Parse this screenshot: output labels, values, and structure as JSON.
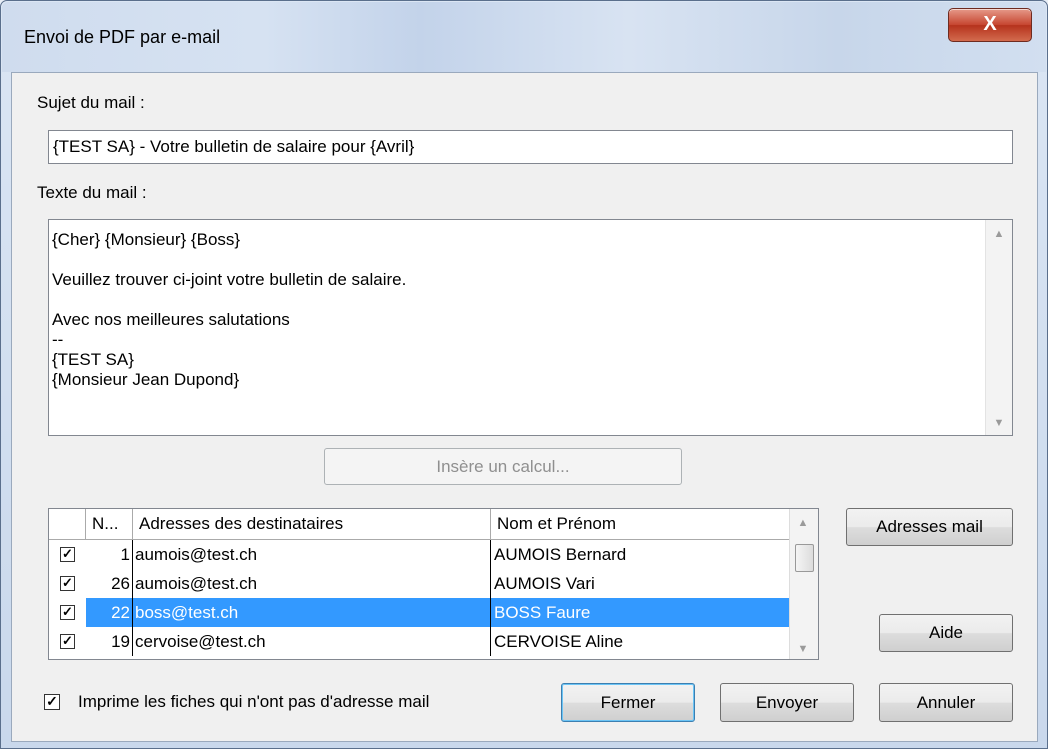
{
  "window": {
    "title": "Envoi de PDF par e-mail",
    "close_glyph": "X"
  },
  "subject": {
    "label": "Sujet du mail :",
    "value": "{TEST SA} - Votre bulletin de salaire pour {Avril}"
  },
  "body": {
    "label": "Texte du mail :",
    "lines": [
      "{Cher} {Monsieur} {Boss}",
      "",
      "Veuillez trouver ci-joint votre bulletin de salaire.",
      "",
      "Avec nos meilleures salutations",
      "--",
      "{TEST SA}",
      "{Monsieur Jean Dupond}"
    ]
  },
  "insert_calc_label": "Insère un calcul...",
  "recipients": {
    "columns": [
      "N...",
      "Adresses des destinataires",
      "Nom et Prénom"
    ],
    "rows": [
      {
        "checked": true,
        "num": "1",
        "email": "aumois@test.ch",
        "name": "AUMOIS Bernard",
        "selected": false
      },
      {
        "checked": true,
        "num": "26",
        "email": "aumois@test.ch",
        "name": "AUMOIS Vari",
        "selected": false
      },
      {
        "checked": true,
        "num": "22",
        "email": "boss@test.ch",
        "name": "BOSS Faure",
        "selected": true
      },
      {
        "checked": true,
        "num": "19",
        "email": "cervoise@test.ch",
        "name": "CERVOISE Aline",
        "selected": false
      }
    ]
  },
  "buttons": {
    "addresses": "Adresses mail",
    "help": "Aide",
    "close": "Fermer",
    "send": "Envoyer",
    "cancel": "Annuler"
  },
  "print_option": {
    "checked": true,
    "label": "Imprime les fiches qui n'ont pas d'adresse mail"
  },
  "colors": {
    "selection": "#3399ff",
    "close_button": "#c6452f"
  }
}
